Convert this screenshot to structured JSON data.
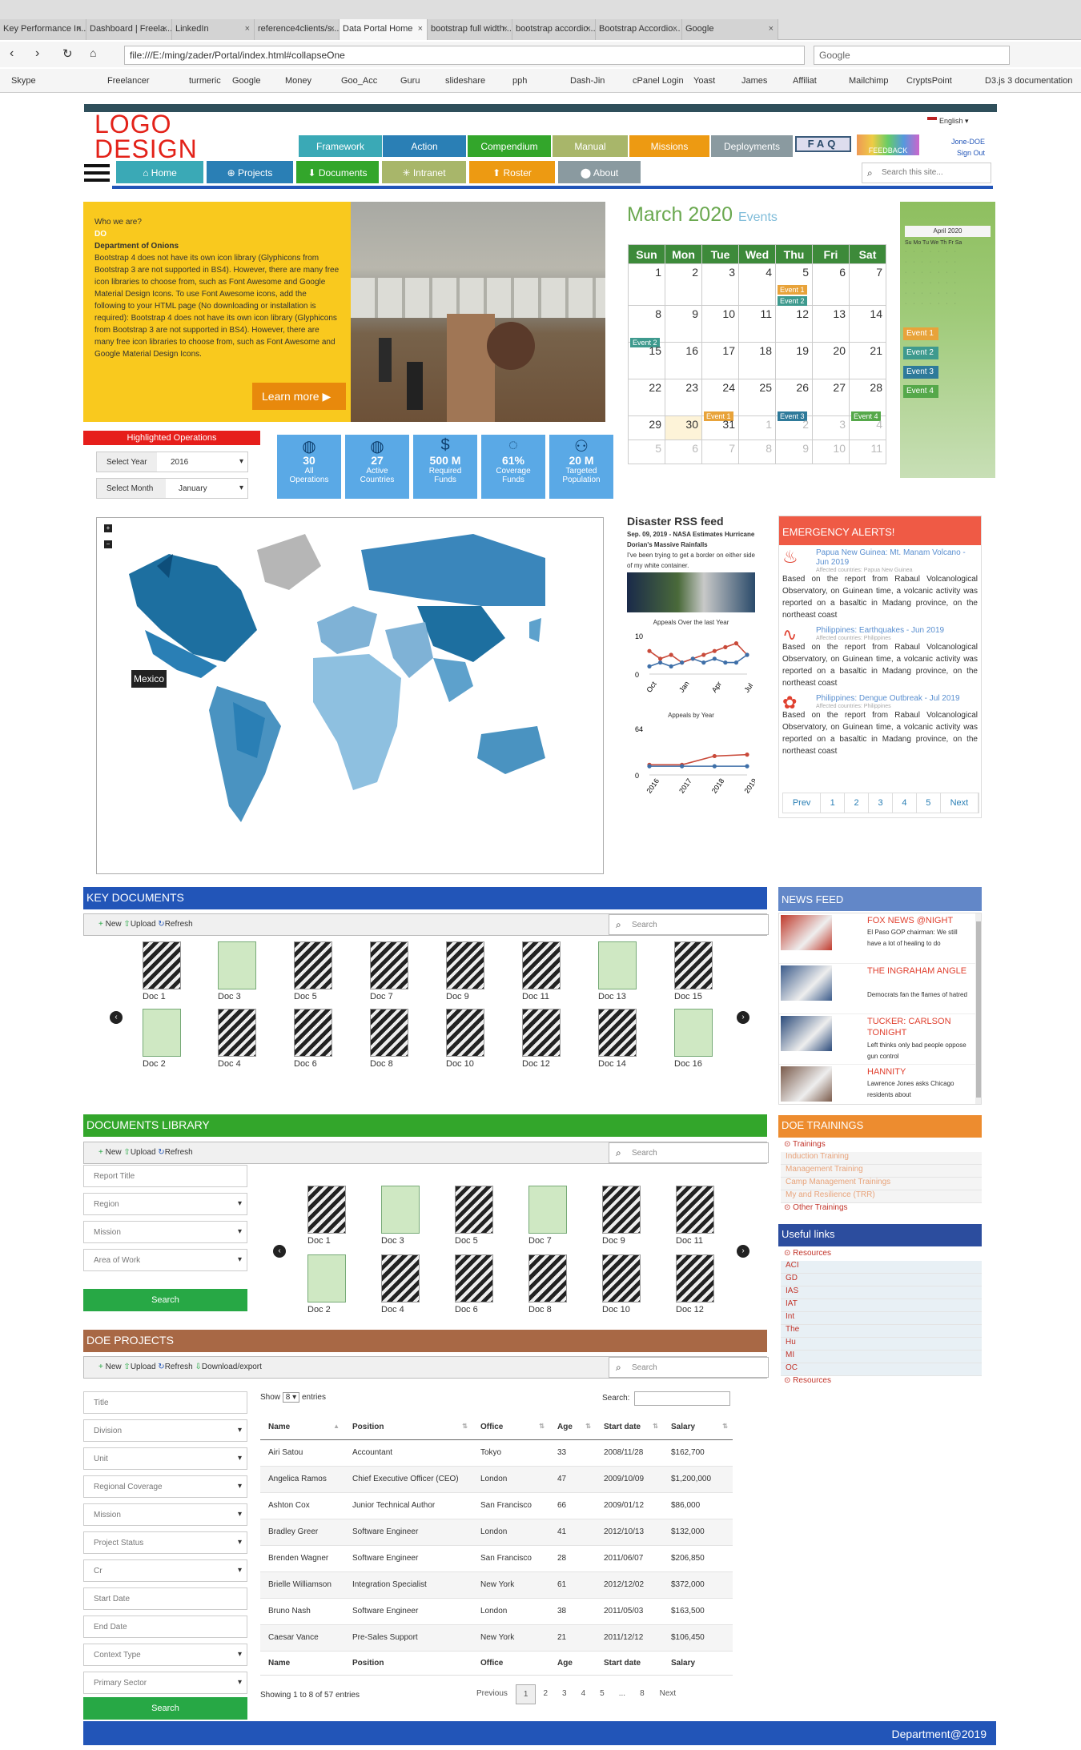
{
  "browser": {
    "tabs": [
      "Key Performance In...",
      "Dashboard | Freela...",
      "LinkedIn",
      "reference4clients/s...",
      "Data Portal Home",
      "bootstrap full width...",
      "bootstrap accordio...",
      "Bootstrap Accordio...",
      "Google"
    ],
    "url": "file:///E:/ming/zader/Portal/index.html#collapseOne",
    "search_placeholder": "Google",
    "bookmarks": [
      "Skype",
      "Freelancer",
      "turmeric",
      "Google",
      "Money",
      "Goo_Acc",
      "Guru",
      "slideshare",
      "pph",
      "Dash-Jin",
      "cPanel Login",
      "Yoast",
      "James",
      "Affiliat",
      "Mailchimp",
      "CryptsPoint",
      "D3.js 3 documentation"
    ]
  },
  "header": {
    "logo_line1": "LOGO",
    "logo_line2": "DESIGN",
    "language": "English",
    "user": "Jone-DOE",
    "signout": "Sign Out",
    "faq": "FAQ",
    "feedback": "FEEDBACK",
    "main_tabs": [
      "Framework",
      "Action",
      "Compendium",
      "Manual",
      "Missions",
      "Deployments"
    ],
    "nav_tabs": [
      "Home",
      "Projects",
      "Documents",
      "Intranet",
      "Roster",
      "About"
    ],
    "search_placeholder": "Search this site..."
  },
  "intro": {
    "who": "Who we are?",
    "do": "DO",
    "dept": "Department of Onions",
    "text": "Bootstrap 4 does not have its own icon library (Glyphicons from Bootstrap 3 are not supported in BS4). However, there are many free icon libraries to choose from, such as Font Awesome and Google Material Design Icons. To use Font Awesome icons, add the following to your HTML page (No downloading or installation is required): Bootstrap 4 does not have its own icon library (Glyphicons from Bootstrap 3 are not supported in BS4). However, there are many free icon libraries to choose from, such as Font Awesome and Google Material Design Icons.",
    "learn_more": "Learn more"
  },
  "highlighted": {
    "title": "Highlighted Operations",
    "select_year_label": "Select Year",
    "select_year": "2016",
    "select_month_label": "Select Month",
    "select_month": "January",
    "stats": [
      {
        "value": "30",
        "label1": "All",
        "label2": "Operations"
      },
      {
        "value": "27",
        "label1": "Active",
        "label2": "Countries"
      },
      {
        "value": "500 M",
        "label1": "Required",
        "label2": "Funds"
      },
      {
        "value": "61%",
        "label1": "Coverage",
        "label2": "Funds"
      },
      {
        "value": "20 M",
        "label1": "Targeted",
        "label2": "Population"
      }
    ]
  },
  "calendar": {
    "month": "March 2020",
    "events_label": "Events",
    "days": [
      "Sun",
      "Mon",
      "Tue",
      "Wed",
      "Thu",
      "Fri",
      "Sat"
    ],
    "weeks": [
      [
        "1",
        "2",
        "3",
        "4",
        "5",
        "6",
        "7"
      ],
      [
        "8",
        "9",
        "10",
        "11",
        "12",
        "13",
        "14"
      ],
      [
        "15",
        "16",
        "17",
        "18",
        "19",
        "20",
        "21"
      ],
      [
        "22",
        "23",
        "24",
        "25",
        "26",
        "27",
        "28"
      ],
      [
        "29",
        "30",
        "31",
        "1",
        "2",
        "3",
        "4"
      ],
      [
        "5",
        "6",
        "7",
        "8",
        "9",
        "10",
        "11"
      ]
    ],
    "events": [
      {
        "week": 0,
        "day": 4,
        "label": "Event 1",
        "color": "#e8a33a",
        "slot": 0
      },
      {
        "week": 0,
        "day": 4,
        "label": "Event 2",
        "color": "#3e9a8e",
        "slot": 1
      },
      {
        "week": 1,
        "day": 0,
        "label": "Event 2",
        "color": "#3e9a8e",
        "slot": 1
      },
      {
        "week": 3,
        "day": 2,
        "label": "Event 1",
        "color": "#e8a33a",
        "slot": 1
      },
      {
        "week": 3,
        "day": 4,
        "label": "Event 3",
        "color": "#2e7a9a",
        "slot": 1
      },
      {
        "week": 3,
        "day": 6,
        "label": "Event 4",
        "color": "#55a84a",
        "slot": 1
      }
    ],
    "mini_month": "April 2020",
    "mini_days": "Su Mo Tu We Th Fr Sa",
    "event_list": [
      {
        "label": "Event 1",
        "color": "#e8a33a"
      },
      {
        "label": "Event 2",
        "color": "#3e9a8e"
      },
      {
        "label": "Event 3",
        "color": "#2e7a9a"
      },
      {
        "label": "Event 4",
        "color": "#55a84a"
      }
    ]
  },
  "map": {
    "tooltip": "Mexico"
  },
  "rss": {
    "title": "Disaster RSS feed",
    "date": "Sep. 09, 2019 - NASA Estimates Hurricane Dorian's Massive Rainfalls",
    "text": "I've been trying to get a border on either side of my white container.",
    "chart1_title": "Appeals Over the last Year",
    "chart2_title": "Appeals by Year"
  },
  "chart_data": [
    {
      "type": "line",
      "title": "Appeals Over the last Year",
      "categories": [
        "Oct",
        "Jan",
        "Apr",
        "Jul"
      ],
      "ylim": [
        0,
        10
      ],
      "yticks": [
        "10",
        "0"
      ],
      "series": [
        {
          "name": "",
          "color": "#c94a3a",
          "values": [
            6,
            4,
            5,
            3,
            4,
            5,
            6,
            7,
            8,
            5
          ]
        },
        {
          "name": "",
          "color": "#3e6fa8",
          "values": [
            2,
            3,
            2,
            3,
            4,
            3,
            4,
            3,
            3,
            5
          ]
        }
      ]
    },
    {
      "type": "line",
      "title": "Appeals by Year",
      "categories": [
        "2016",
        "2017",
        "2018",
        "2019"
      ],
      "ylim": [
        0,
        64
      ],
      "yticks": [
        "64",
        "0"
      ],
      "series": [
        {
          "name": "",
          "color": "#c94a3a",
          "values": [
            14,
            14,
            26,
            28
          ]
        },
        {
          "name": "",
          "color": "#3e6fa8",
          "values": [
            12,
            12,
            12,
            12
          ]
        }
      ]
    }
  ],
  "alerts": {
    "title": "EMERGENCY ALERTS!",
    "items": [
      {
        "title": "Papua New Guinea: Mt. Manam Volcano - Jun 2019",
        "affected": "Affected countries: Papua New Guinea",
        "body": "Based on the report from Rabaul Volcanological Observatory, on Guinean time, a volcanic activity was reported on a basaltic in Madang province, on the northeast coast"
      },
      {
        "title": "Philippines: Earthquakes - Jun 2019",
        "affected": "Affected countries: Philippines",
        "body": "Based on the report from Rabaul Volcanological Observatory, on Guinean time, a volcanic activity was reported on a basaltic in Madang province, on the northeast coast"
      },
      {
        "title": "Philippines: Dengue Outbreak - Jul 2019",
        "affected": "Affected countries: Philippines",
        "body": "Based on the report from Rabaul Volcanological Observatory, on Guinean time, a volcanic activity was reported on a basaltic in Madang province, on the northeast coast"
      }
    ],
    "pager": [
      "Prev",
      "1",
      "2",
      "3",
      "4",
      "5",
      "Next"
    ]
  },
  "key_docs": {
    "title": "KEY DOCUMENTS",
    "new": "New",
    "upload": "Upload",
    "refresh": "Refresh",
    "search": "Search",
    "docs": [
      [
        "Doc 1",
        "Doc 3",
        "Doc 5",
        "Doc 7",
        "Doc 9",
        "Doc 11",
        "Doc 13",
        "Doc 15"
      ],
      [
        "Doc 2",
        "Doc 4",
        "Doc 6",
        "Doc 8",
        "Doc 10",
        "Doc 12",
        "Doc 14",
        "Doc 16"
      ]
    ]
  },
  "news": {
    "title": "NEWS FEED",
    "items": [
      {
        "title": "FOX NEWS @NIGHT",
        "text": "El Paso GOP chairman: We still have a lot of healing to do"
      },
      {
        "title": "THE INGRAHAM ANGLE",
        "text": "Democrats fan the flames of hatred"
      },
      {
        "title": "TUCKER: CARLSON TONIGHT",
        "text": "Left thinks only bad people oppose gun control"
      },
      {
        "title": "HANNITY",
        "text": "Lawrence Jones asks Chicago residents about"
      }
    ]
  },
  "docs_library": {
    "title": "DOCUMENTS LIBRARY",
    "new": "New",
    "upload": "Upload",
    "refresh": "Refresh",
    "search": "Search",
    "filters": [
      "Report Title",
      "Region",
      "Mission",
      "Area of Work"
    ],
    "search_button": "Search",
    "docs": [
      [
        "Doc 1",
        "Doc 3",
        "Doc 5",
        "Doc 7",
        "Doc 9",
        "Doc 11"
      ],
      [
        "Doc 2",
        "Doc 4",
        "Doc 6",
        "Doc 8",
        "Doc 10",
        "Doc 12"
      ]
    ]
  },
  "trainings": {
    "title": "DOE TRAININGS",
    "group1": "Trainings",
    "items": [
      "Induction Training",
      "Management Training",
      "Camp Management Trainings",
      "My and Resilience (TRR)"
    ],
    "group2": "Other Trainings"
  },
  "useful_links": {
    "title": "Useful links",
    "group1": "Resources",
    "items": [
      "ACI",
      "GD",
      "IAS",
      "IAT",
      "Int",
      "The",
      "Hu",
      "MI",
      "OC"
    ],
    "group2": "Resources"
  },
  "projects": {
    "title": "DOE PROJECTS",
    "new": "New",
    "upload": "Upload",
    "refresh": "Refresh",
    "download": "Download/export",
    "search": "Search",
    "filters": [
      "Title",
      "Division",
      "Unit",
      "Regional Coverage",
      "Mission",
      "Project Status",
      "Cr",
      "Start Date",
      "End Date",
      "Context Type",
      "Primary Sector"
    ],
    "search_button": "Search",
    "show": "Show",
    "show_value": "8",
    "entries": "entries",
    "table_search": "Search:",
    "columns": [
      "Name",
      "Position",
      "Office",
      "Age",
      "Start date",
      "Salary"
    ],
    "rows": [
      [
        "Airi Satou",
        "Accountant",
        "Tokyo",
        "33",
        "2008/11/28",
        "$162,700"
      ],
      [
        "Angelica Ramos",
        "Chief Executive Officer (CEO)",
        "London",
        "47",
        "2009/10/09",
        "$1,200,000"
      ],
      [
        "Ashton Cox",
        "Junior Technical Author",
        "San Francisco",
        "66",
        "2009/01/12",
        "$86,000"
      ],
      [
        "Bradley Greer",
        "Software Engineer",
        "London",
        "41",
        "2012/10/13",
        "$132,000"
      ],
      [
        "Brenden Wagner",
        "Software Engineer",
        "San Francisco",
        "28",
        "2011/06/07",
        "$206,850"
      ],
      [
        "Brielle Williamson",
        "Integration Specialist",
        "New York",
        "61",
        "2012/12/02",
        "$372,000"
      ],
      [
        "Bruno Nash",
        "Software Engineer",
        "London",
        "38",
        "2011/05/03",
        "$163,500"
      ],
      [
        "Caesar Vance",
        "Pre-Sales Support",
        "New York",
        "21",
        "2011/12/12",
        "$106,450"
      ]
    ],
    "info": "Showing 1 to 8 of 57 entries",
    "pager": [
      "Previous",
      "1",
      "2",
      "3",
      "4",
      "5",
      "...",
      "8",
      "Next"
    ]
  },
  "footer": {
    "text": "Department@2019"
  },
  "colors": {
    "red": "#e32219",
    "green": "#27a845",
    "blue": "#2255b8"
  }
}
